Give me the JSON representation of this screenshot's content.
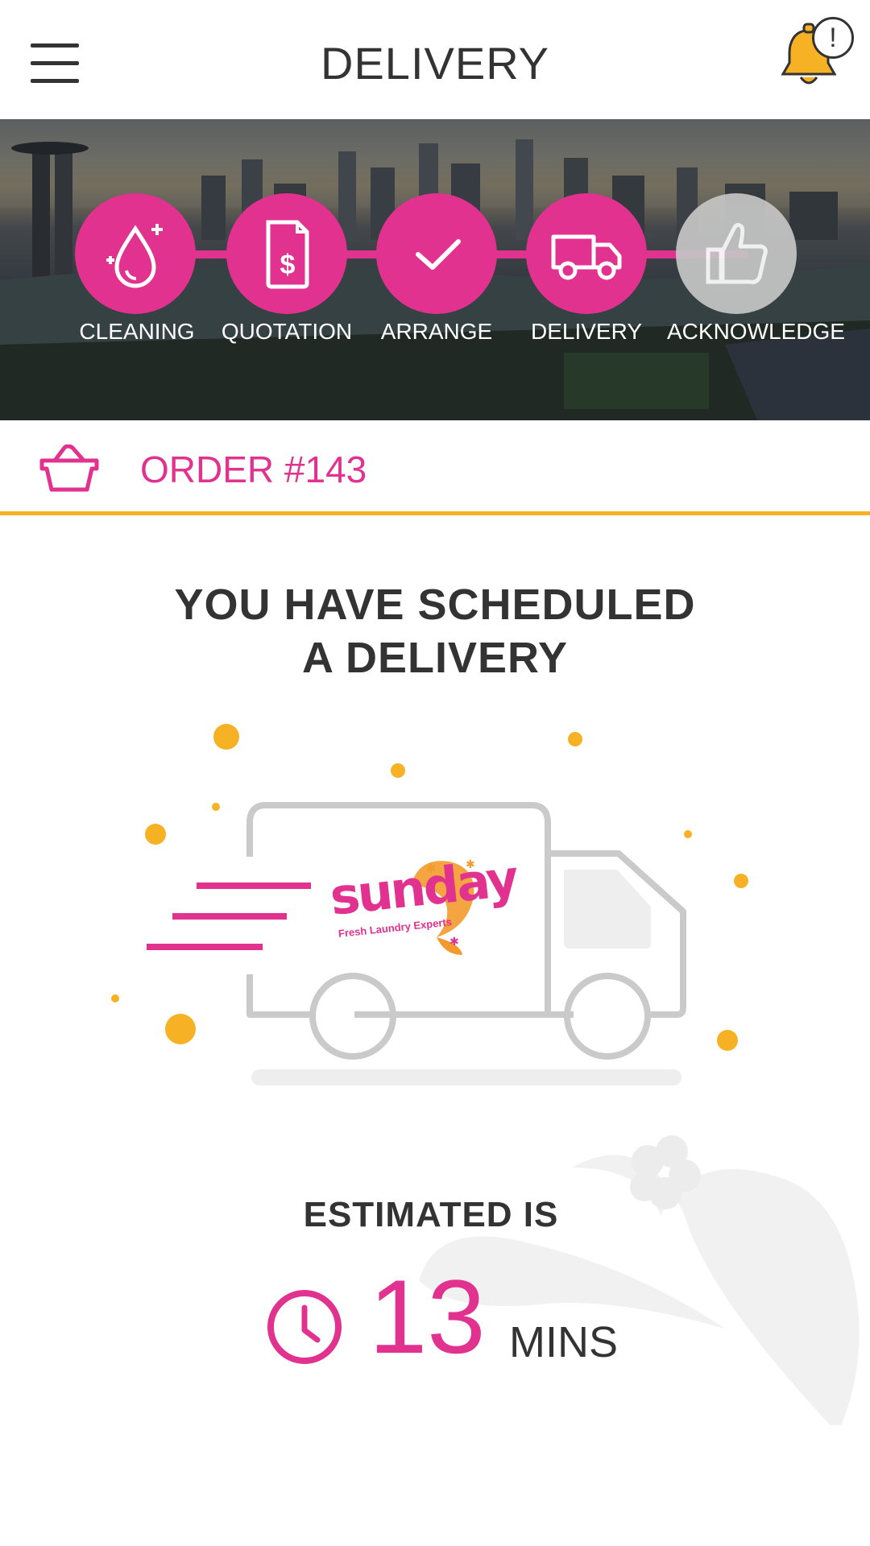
{
  "header": {
    "title": "DELIVERY",
    "notification_badge": "!"
  },
  "progress": {
    "steps": [
      {
        "label": "CLEANING",
        "icon": "water-drop-icon",
        "completed": true
      },
      {
        "label": "QUOTATION",
        "icon": "invoice-dollar-icon",
        "completed": true
      },
      {
        "label": "ARRANGE",
        "icon": "checkmark-icon",
        "completed": true
      },
      {
        "label": "DELIVERY",
        "icon": "truck-icon",
        "completed": true
      },
      {
        "label": "ACKNOWLEDGE",
        "icon": "thumbs-up-icon",
        "completed": false
      }
    ]
  },
  "order": {
    "label": "ORDER #143",
    "icon": "basket-icon"
  },
  "main": {
    "headline_line1": "YOU HAVE SCHEDULED",
    "headline_line2": "A DELIVERY",
    "brand_name": "sunday",
    "brand_tagline": "Fresh Laundry Experts"
  },
  "estimate": {
    "label": "ESTIMATED IS",
    "value": "13",
    "unit": "MINS",
    "icon": "clock-icon"
  },
  "colors": {
    "accent": "#e1328f",
    "divider": "#f7b124",
    "bell": "#f7b124",
    "inactive_step": "#c6c6c6",
    "text": "#333333"
  }
}
